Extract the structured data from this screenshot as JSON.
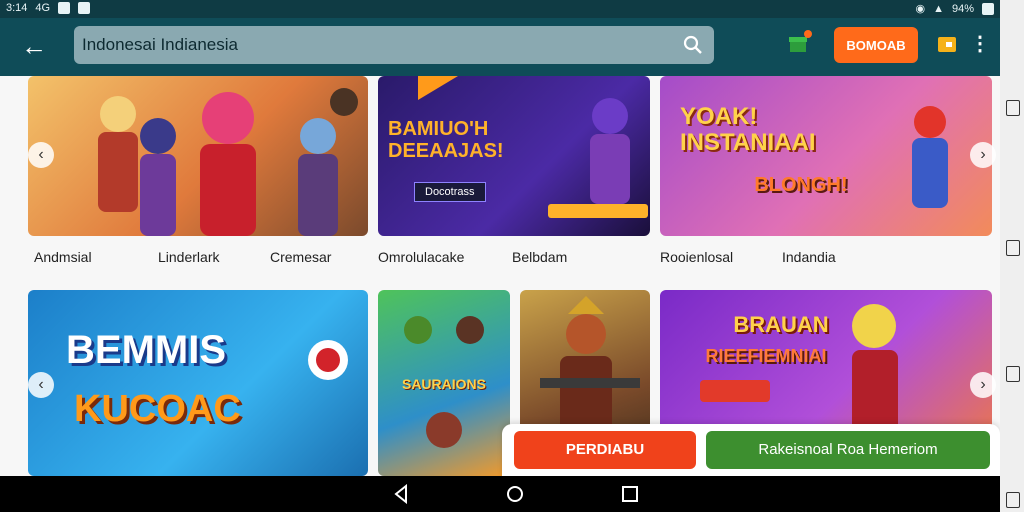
{
  "status_bar": {
    "time": "3:14",
    "signal": "4G",
    "battery": "94%"
  },
  "app_bar": {
    "search_value": "Indonesai Indianesia",
    "download_label": "BOMOAB"
  },
  "carousel_row_1": [
    {
      "art_title": "",
      "art_subtitle": ""
    },
    {
      "art_title": "BAMIUO'H DEEAAJAS!",
      "art_subtitle": "Docotrass"
    },
    {
      "art_title": "YOAK! INSTANIAAI",
      "art_subtitle": "BLONGH!"
    }
  ],
  "captions": [
    "Andmsial",
    "Linderlark",
    "Cremesar",
    "Omrolulacake",
    "Belbdam",
    "Rooienlosal",
    "Indandia"
  ],
  "carousel_row_2": [
    {
      "art_title": "BEMMIS",
      "art_subtitle": "KUCOAC"
    },
    {
      "art_title": "SAURAIONS",
      "art_subtitle": ""
    },
    {
      "art_title": "",
      "art_subtitle": ""
    },
    {
      "art_title": "BRAUAN",
      "art_subtitle": "RIEEFIEMNIAI"
    }
  ],
  "actions": {
    "primary": "PERDIABU",
    "secondary": "Rakeisnoal Roa Hemeriom"
  },
  "colors": {
    "app_bar": "#0f4c58",
    "download": "#ff6a1a",
    "primary_btn": "#f0421b",
    "secondary_btn": "#3d8f2f"
  }
}
